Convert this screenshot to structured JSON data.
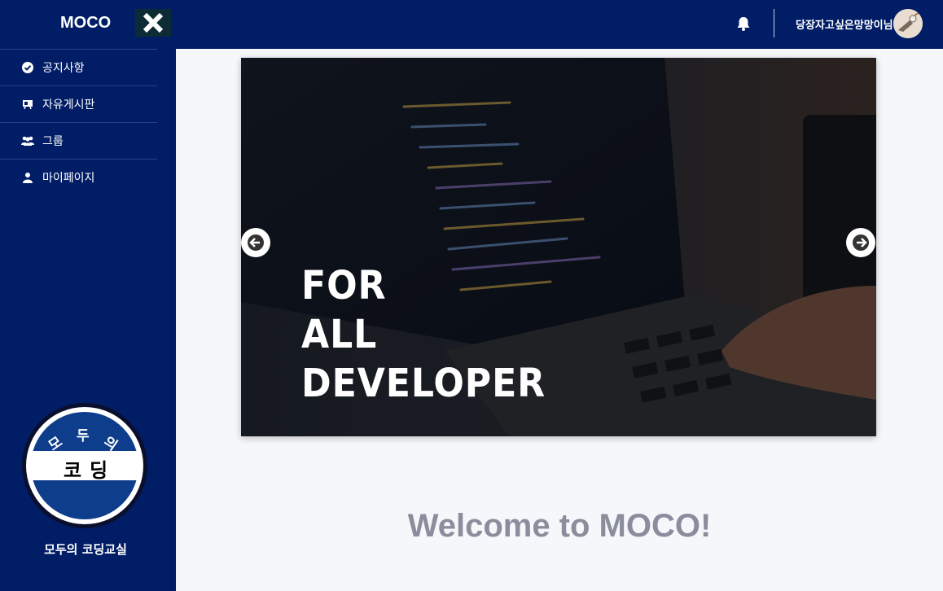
{
  "header": {
    "brand": "MOCO",
    "username": "당장자고싶은망망이님"
  },
  "sidebar": {
    "items": [
      {
        "label": "공지사항",
        "icon": "check-circle-icon"
      },
      {
        "label": "자유게시판",
        "icon": "board-icon"
      },
      {
        "label": "그룹",
        "icon": "users-icon"
      },
      {
        "label": "마이페이지",
        "icon": "user-icon"
      }
    ],
    "logo_text": [
      "모",
      "두",
      "의",
      "코",
      "딩"
    ],
    "caption": "모두의 코딩교실"
  },
  "carousel": {
    "lines": [
      "FOR",
      "ALL",
      "DEVELOPER"
    ]
  },
  "main": {
    "welcome": "Welcome to MOCO!"
  },
  "colors": {
    "navy": "#001d66",
    "background": "#f6f7fb",
    "welcome_text": "#8a8d9c"
  }
}
